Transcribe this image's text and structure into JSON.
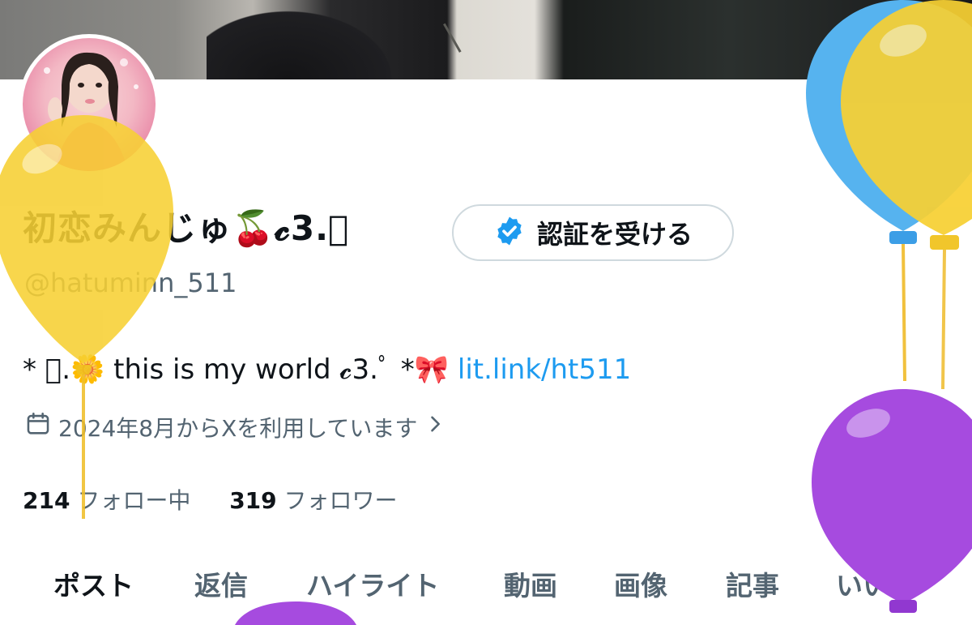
{
  "profile": {
    "display_name": "初恋みんじゅ🍒𝓬3.ﾟ",
    "handle": "@hatuminn_511",
    "verify_button_label": "認証を受ける",
    "bio_text": "* ﾟ.🌼 this is my world 𝓬3.ﾟ *🎀 ",
    "bio_link": "lit.link/ht511",
    "joined_text": "2024年8月からXを利用しています",
    "following_count": "214",
    "following_label": "フォロー中",
    "followers_count": "319",
    "followers_label": "フォロワー"
  },
  "tabs": [
    {
      "label": "ポスト",
      "active": true
    },
    {
      "label": "返信"
    },
    {
      "label": "ハイライト"
    },
    {
      "label": "動画"
    },
    {
      "label": "画像"
    },
    {
      "label": "記事"
    },
    {
      "label": "いいね"
    }
  ],
  "icons": {
    "verified": "verified-badge-icon",
    "calendar": "calendar-icon",
    "chevron": "chevron-right-icon"
  },
  "colors": {
    "accent": "#1d9bf0",
    "muted": "#536471",
    "balloon_yellow": "#f7d033",
    "balloon_blue": "#56b3ef",
    "balloon_purple": "#a64bdf"
  }
}
